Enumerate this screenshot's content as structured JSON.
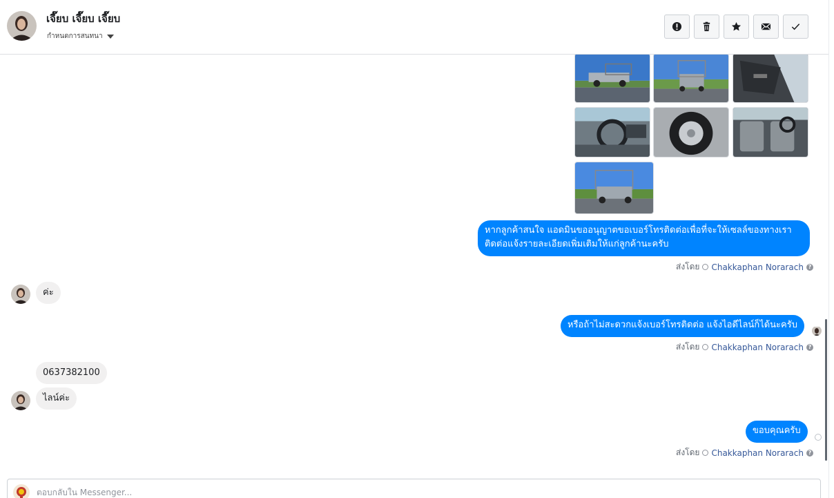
{
  "header": {
    "contact_name": "เจี๊ยบ เจี๊ยบ เจี๊ยบ",
    "status_label": "กำหนดการสนทนา",
    "actions": [
      {
        "name": "report-button",
        "icon": "exclamation-icon"
      },
      {
        "name": "delete-button",
        "icon": "trash-icon"
      },
      {
        "name": "star-button",
        "icon": "star-icon"
      },
      {
        "name": "mark-unread-button",
        "icon": "envelope-icon"
      },
      {
        "name": "mark-done-button",
        "icon": "check-icon"
      }
    ]
  },
  "photos": [
    {
      "subject": "pickup-truck-side"
    },
    {
      "subject": "pickup-truck-rear"
    },
    {
      "subject": "door-interior"
    },
    {
      "subject": "dashboard-steering"
    },
    {
      "subject": "wheel"
    },
    {
      "subject": "seats-interior"
    },
    {
      "subject": "pickup-truck-rear-angle"
    }
  ],
  "messages": {
    "m1": "หากลูกค้าสนใจ แอดมินขออนุญาตขอเบอร์โทรติดต่อเพื่อที่จะให้เซลล์ของทางเรา",
    "m1b": "ติดต่อแจ้งรายละเอียดเพิ่มเติมให้แก่ลูกค้านะครับ",
    "m2": "ค่ะ",
    "m3": "หรือถ้าไม่สะดวกแจ้งเบอร์โทรติดต่อ แจ้งไอดีไลน์ก็ได้นะครับ",
    "m4": "0637382100",
    "m5": "ไลน์ค่ะ",
    "m6": "ขอบคุณครับ"
  },
  "sent_by": {
    "prefix": "ส่งโดย",
    "agent": "Chakkaphan Norarach",
    "help": "?"
  },
  "composer": {
    "placeholder": "ตอบกลับใน Messenger..."
  },
  "colors": {
    "outgoing_bubble": "#0084ff",
    "incoming_bubble": "#f1f0f0",
    "agent_link": "#365899"
  }
}
